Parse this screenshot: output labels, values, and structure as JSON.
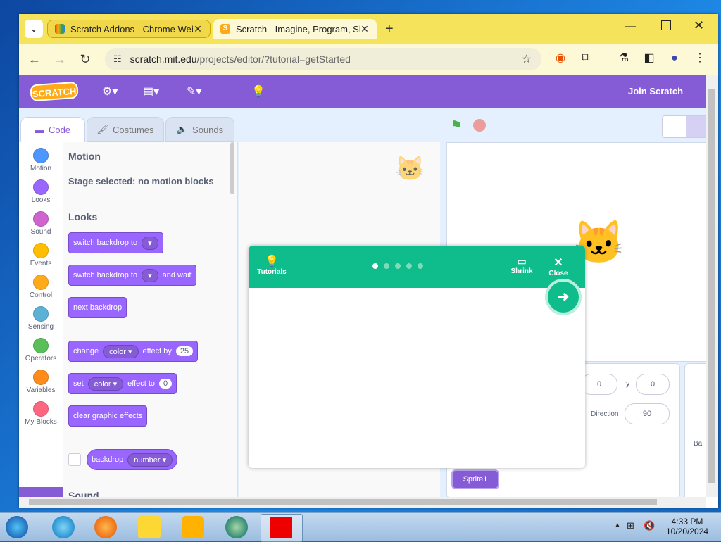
{
  "browser": {
    "tabs": [
      {
        "title": "Scratch Addons - Chrome Web Store",
        "favicon": "rainbow-icon"
      },
      {
        "title": "Scratch - Imagine, Program, Share",
        "favicon": "scratch-s-icon"
      }
    ],
    "url_host": "scratch.mit.edu",
    "url_path": "/projects/editor/?tutorial=getStarted"
  },
  "scratch": {
    "menu": {
      "logo": "SCRATCH",
      "join": "Join Scratch"
    },
    "editor_tabs": [
      "Code",
      "Costumes",
      "Sounds"
    ],
    "categories": [
      {
        "label": "Motion",
        "color": "#4c97ff"
      },
      {
        "label": "Looks",
        "color": "#9966ff"
      },
      {
        "label": "Sound",
        "color": "#cf63cf"
      },
      {
        "label": "Events",
        "color": "#ffbf00"
      },
      {
        "label": "Control",
        "color": "#ffab19"
      },
      {
        "label": "Sensing",
        "color": "#5cb1d6"
      },
      {
        "label": "Operators",
        "color": "#59c059"
      },
      {
        "label": "Variables",
        "color": "#ff8c1a"
      },
      {
        "label": "My Blocks",
        "color": "#ff6680"
      }
    ],
    "palette": {
      "motion_title": "Motion",
      "motion_note": "Stage selected: no motion blocks",
      "looks_title": "Looks",
      "blocks": {
        "switch_backdrop": "switch backdrop to",
        "switch_backdrop_wait": "switch backdrop to",
        "and_wait": "and wait",
        "next_backdrop": "next backdrop",
        "change": "change",
        "color": "color",
        "effect_by": "effect by",
        "change_value": "25",
        "set": "set",
        "effect_to": "effect to",
        "set_value": "0",
        "clear": "clear graphic effects",
        "backdrop": "backdrop",
        "number": "number"
      },
      "sound_title": "Sound"
    },
    "sprite_info": {
      "x": "0",
      "y_label": "y",
      "y": "0",
      "direction_label": "Direction",
      "direction": "90",
      "sprite_name": "Sprite1",
      "side_label": "Ba"
    },
    "tutorial": {
      "tutorials_label": "Tutorials",
      "shrink_label": "Shrink",
      "close_label": "Close",
      "step_count": 5,
      "current_step": 1
    }
  },
  "taskbar": {
    "time": "4:33 PM",
    "date": "10/20/2024"
  }
}
